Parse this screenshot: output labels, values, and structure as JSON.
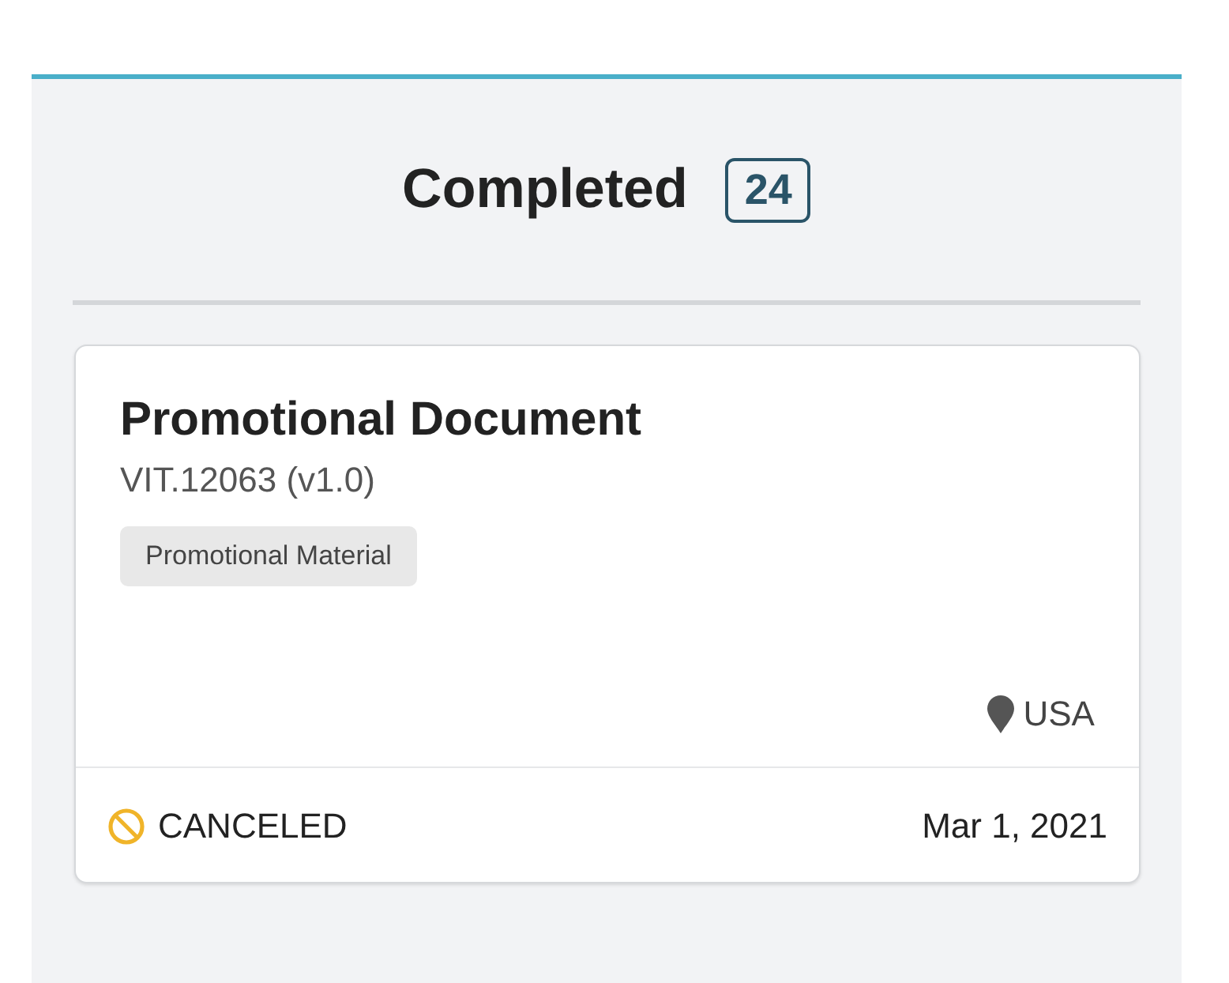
{
  "column": {
    "title": "Completed",
    "count": "24"
  },
  "cards": [
    {
      "title": "Promotional Document",
      "document_id": "VIT.12063 (v1.0)",
      "tags": [
        "Promotional Material"
      ],
      "location": "USA",
      "status": {
        "kind": "canceled",
        "label": "CANCELED"
      },
      "date": "Mar 1, 2021"
    }
  ]
}
